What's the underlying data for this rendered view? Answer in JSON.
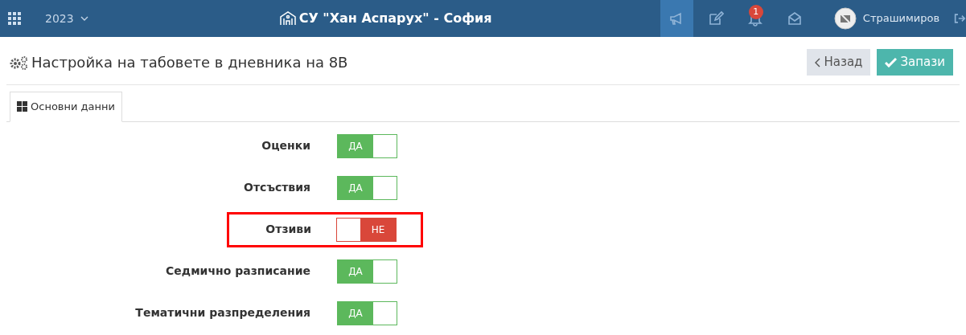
{
  "topbar": {
    "year": "2023",
    "school": "СУ \"Хан Аспарух\" - София",
    "actions": [
      {
        "kind": "megaphone",
        "selected": true
      },
      {
        "kind": "edit",
        "selected": false
      },
      {
        "kind": "bell",
        "selected": false,
        "badge": "1"
      },
      {
        "kind": "mail",
        "selected": false
      }
    ],
    "user": "Страшимиров"
  },
  "page": {
    "title": "Настройка на табовете в дневника на 8В",
    "buttons": [
      {
        "kind": "back",
        "label": "Назад"
      },
      {
        "kind": "save",
        "label": "Запази"
      }
    ]
  },
  "tabs": [
    {
      "label": "Основни данни",
      "selected": true
    }
  ],
  "settings": [
    {
      "label": "Оценки",
      "on": true,
      "state_text": "ДА",
      "highlighted": false
    },
    {
      "label": "Отсъствия",
      "on": true,
      "state_text": "ДА",
      "highlighted": false
    },
    {
      "label": "Отзиви",
      "on": false,
      "state_text": "НЕ",
      "highlighted": true
    },
    {
      "label": "Седмично разписание",
      "on": true,
      "state_text": "ДА",
      "highlighted": false
    },
    {
      "label": "Тематични разпределения",
      "on": true,
      "state_text": "ДА",
      "highlighted": false
    }
  ]
}
